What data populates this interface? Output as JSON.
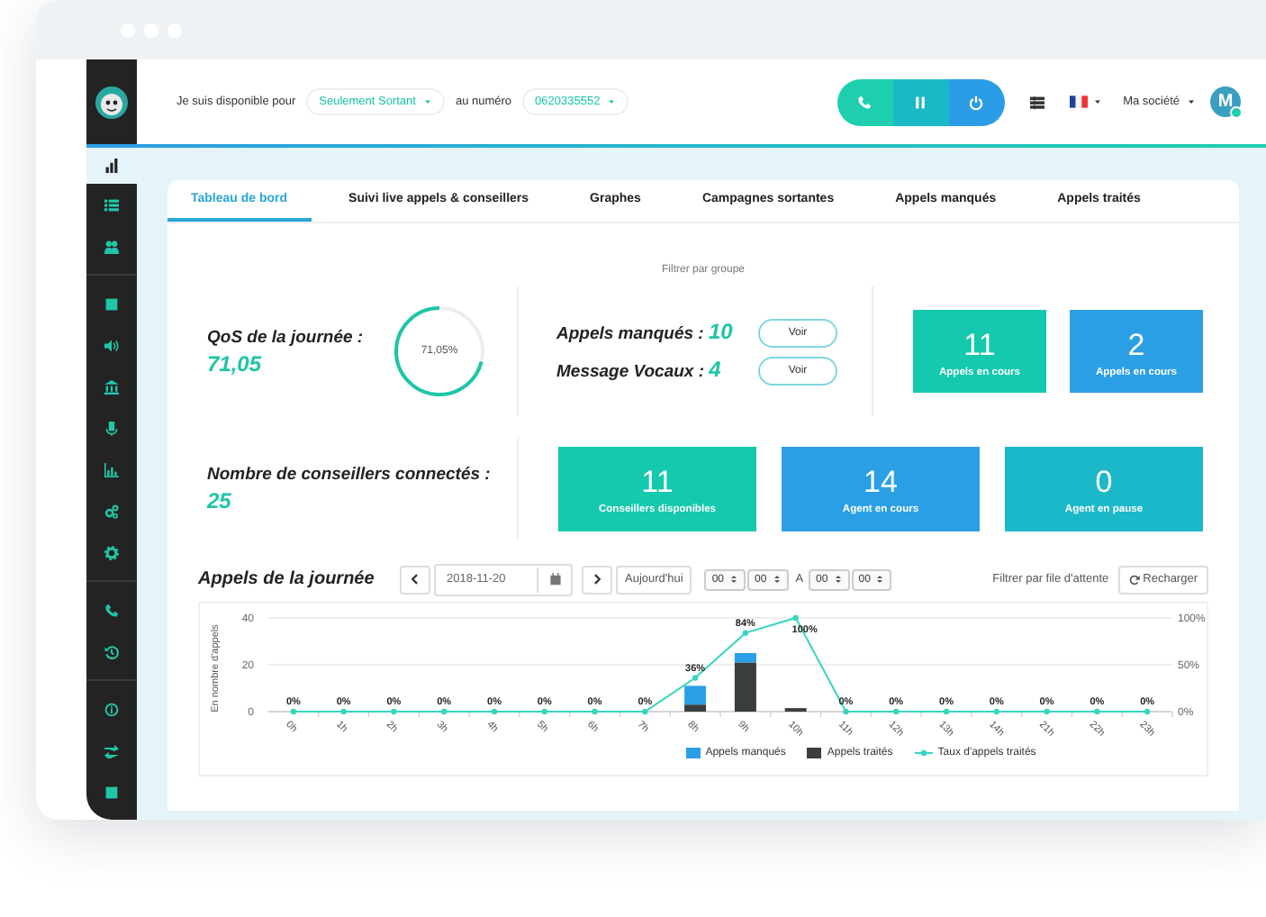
{
  "header": {
    "availability_label": "Je suis disponible pour",
    "mode_dropdown": "Seulement Sortant",
    "number_label": "au numéro",
    "number_dropdown": "0620335552",
    "company": "Ma société",
    "avatar": {
      "initial": "M",
      "online": true
    }
  },
  "sidebar": {
    "groups": [
      [
        {
          "selected": true
        }
      ],
      [
        {
          "selected": false
        },
        {
          "selected": false
        }
      ],
      [
        {
          "selected": false
        },
        {
          "selected": false
        },
        {
          "selected": false
        },
        {
          "selected": false
        },
        {
          "selected": false
        },
        {
          "selected": false
        },
        {
          "selected": false
        }
      ],
      [
        {
          "selected": false
        },
        {
          "selected": false
        }
      ],
      [
        {
          "selected": false
        },
        {
          "selected": false
        },
        {
          "selected": false
        }
      ]
    ]
  },
  "tabs": [
    {
      "label": "Tableau de bord",
      "selected": true
    },
    {
      "label": "Suivi live appels & conseillers",
      "selected": false
    },
    {
      "label": "Graphes",
      "selected": false
    },
    {
      "label": "Campagnes sortantes",
      "selected": false
    },
    {
      "label": "Appels manqués",
      "selected": false
    },
    {
      "label": "Appels traités",
      "selected": false
    }
  ],
  "dashboard": {
    "filter_label": "Filtrer par groupe",
    "qos": {
      "label": "QoS de la journée :",
      "value": "71,05",
      "gauge_text": "71,05%",
      "level": 0.7105
    },
    "counters": [
      {
        "label": "Appels manqués :",
        "value": "10",
        "button": "Voir"
      },
      {
        "label": "Message Vocaux :",
        "value": "4",
        "button": "Voir"
      }
    ],
    "top_tiles": [
      {
        "value": "11",
        "label": "Appels en cours",
        "color": "#14c9ad"
      },
      {
        "value": "2",
        "label": "Appels en cours",
        "color": "#2b9fe6"
      }
    ],
    "advisors": {
      "label": "Nombre de conseillers connectés :",
      "value": "25"
    },
    "bottom_tiles": [
      {
        "value": "11",
        "label": "Conseillers disponibles",
        "color": "#14c9ad"
      },
      {
        "value": "14",
        "label": "Agent en cours",
        "color": "#2b9fe6"
      },
      {
        "value": "0",
        "label": "Agent en pause",
        "color": "#1bb8c9"
      }
    ]
  },
  "calls_chart": {
    "title": "Appels de la journée",
    "date": "2018-11-20",
    "today_button": "Aujourd'hui",
    "time_from": [
      "00",
      "00"
    ],
    "separator": "A",
    "time_to": [
      "00",
      "00"
    ],
    "queue_filter_label": "Filtrer par file d'attente",
    "reload_button": "Recharger",
    "chart_data": {
      "type": "bar",
      "stacked": true,
      "legend": "bottom",
      "ylabel": "En nombre d'appels",
      "ylim": [
        0,
        40
      ],
      "yticks": [
        0,
        20,
        40
      ],
      "categories": [
        "0h",
        "1h",
        "2h",
        "3h",
        "4h",
        "5h",
        "6h",
        "7h",
        "8h",
        "9h",
        "10h",
        "11h",
        "12h",
        "13h",
        "14h",
        "21h",
        "22h",
        "23h"
      ],
      "series": [
        {
          "name": "Appels manqués",
          "color": "#2b9fe6",
          "type": "bar",
          "values": [
            0,
            0,
            0,
            0,
            0,
            0,
            0,
            0,
            8,
            4,
            0,
            0,
            0,
            0,
            0,
            0,
            0,
            0
          ]
        },
        {
          "name": "Appels traités",
          "color": "#3a3d3d",
          "type": "bar",
          "values": [
            0,
            0,
            0,
            0,
            0,
            0,
            0,
            0,
            3,
            21,
            1.5,
            0,
            0,
            0,
            0,
            0,
            0,
            0
          ]
        }
      ]
    },
    "rate_chart": {
      "chart_data": {
        "type": "line",
        "categories": [
          null,
          null,
          null,
          null,
          null,
          null,
          null,
          null,
          null,
          null,
          null,
          null,
          null,
          null,
          null,
          null,
          null,
          null
        ],
        "ylim": [
          0,
          100
        ],
        "yticks": [
          {
            "value": 0,
            "label": "0%"
          },
          {
            "value": 50,
            "label": "50%"
          },
          {
            "value": 100,
            "label": "100%"
          }
        ],
        "series": [
          {
            "name": "Taux d'appels traités",
            "color": "#36d6bd",
            "marker": "circle",
            "values": [
              0,
              0,
              0,
              0,
              0,
              0,
              0,
              0,
              36,
              84,
              100,
              0,
              0,
              0,
              0,
              0,
              0,
              0
            ],
            "value_labels": [
              "0%",
              "0%",
              "0%",
              "0%",
              "0%",
              "0%",
              "0%",
              "0%",
              "36%",
              "84%",
              "100%",
              "0%",
              "0%",
              "0%",
              "0%",
              "0%",
              "0%",
              "0%"
            ]
          }
        ]
      }
    }
  }
}
